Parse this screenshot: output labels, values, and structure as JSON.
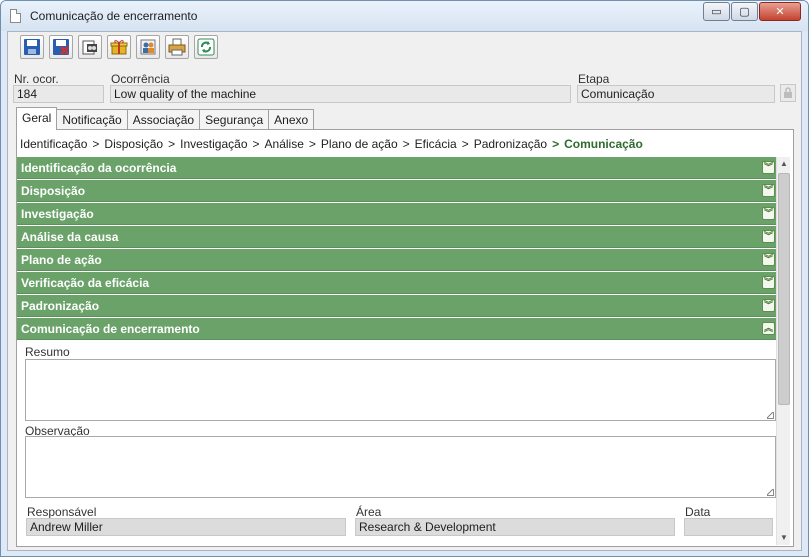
{
  "window": {
    "title": "Comunicação de encerramento",
    "controls": {
      "minimize": "▭",
      "maximize": "▢",
      "close": "✕"
    }
  },
  "toolbar": {
    "buttons": [
      {
        "name": "save-icon",
        "color": "#2a5db0"
      },
      {
        "name": "save-close-icon",
        "color": "#c0392b"
      },
      {
        "name": "view-icon",
        "color": "#444444"
      },
      {
        "name": "gift-icon",
        "color": "#d4a017"
      },
      {
        "name": "people-icon",
        "color": "#3a6ea5"
      },
      {
        "name": "print-icon",
        "color": "#666666"
      },
      {
        "name": "refresh-icon",
        "color": "#2e8b57"
      }
    ]
  },
  "header": {
    "nr_label": "Nr. ocor.",
    "nr_value": "184",
    "ocorrencia_label": "Ocorrência",
    "ocorrencia_value": "Low quality of the machine",
    "etapa_label": "Etapa",
    "etapa_value": "Comunicação"
  },
  "tabs": [
    "Geral",
    "Notificação",
    "Associação",
    "Segurança",
    "Anexo"
  ],
  "breadcrumb": {
    "steps": [
      "Identificação",
      "Disposição",
      "Investigação",
      "Análise",
      "Plano de ação",
      "Eficácia",
      "Padronização"
    ],
    "current": "Comunicação",
    "separator": ">"
  },
  "sections": [
    "Identificação da ocorrência",
    "Disposição",
    "Investigação",
    "Análise da causa",
    "Plano de ação",
    "Verificação da eficácia",
    "Padronização",
    "Comunicação de encerramento"
  ],
  "closing": {
    "resumo_label": "Resumo",
    "resumo_value": "",
    "observacao_label": "Observação",
    "observacao_value": "",
    "responsavel_label": "Responsável",
    "responsavel_value": "Andrew Miller",
    "area_label": "Área",
    "area_value": "Research & Development",
    "data_label": "Data",
    "data_value": ""
  },
  "colors": {
    "section_bg": "#6aa26a",
    "breadcrumb_current": "#2e6b2e"
  }
}
